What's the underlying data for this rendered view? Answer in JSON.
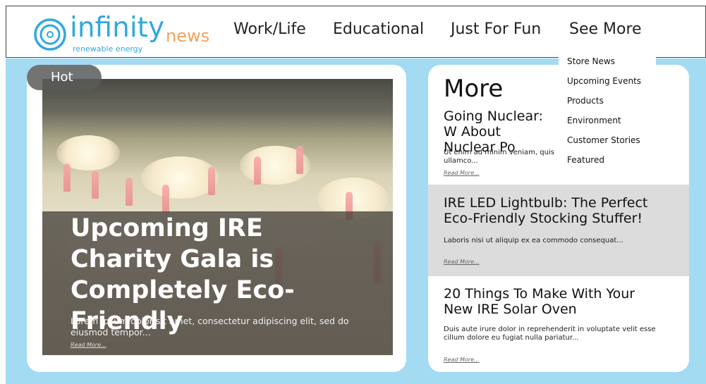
{
  "logo": {
    "word": "infinity",
    "tagline": "renewable energy",
    "section": "news"
  },
  "nav": {
    "items": [
      "Work/Life",
      "Educational",
      "Just For Fun",
      "See More"
    ]
  },
  "dropdown": {
    "items": [
      "Store News",
      "Upcoming Events",
      "Products",
      "Environment",
      "Customer Stories",
      "Featured"
    ]
  },
  "featured": {
    "badge": "Hot",
    "title": "Upcoming IRE Charity Gala is Completely Eco-Friendly",
    "excerpt": "Lorem ipsum dolor sit amet, consectetur adipiscing elit, sed do eiusmod tempor...",
    "read_more": "Read More..."
  },
  "more": {
    "heading": "More",
    "articles": [
      {
        "title": "Going Nuclear: W About Nuclear Po",
        "excerpt": "Ut enim ad minim veniam, quis ullamco...",
        "read_more": "Read More..."
      },
      {
        "title": "IRE LED Lightbulb: The Perfect Eco-Friendly Stocking Stuffer!",
        "excerpt": "Laboris nisi ut aliquip ex ea commodo consequat...",
        "read_more": "Read More..."
      },
      {
        "title": "20 Things To Make With Your New IRE Solar Oven",
        "excerpt": "Duis aute irure dolor in reprehenderit in voluptate velit esse cillum dolore eu fugiat nulla pariatur...",
        "read_more": "Read More..."
      }
    ]
  },
  "colors": {
    "brand_blue": "#35a8dc",
    "brand_orange": "#f3a15b",
    "background_blue": "#a3dbf2",
    "highlight_gray": "#dcdcdc"
  },
  "icons": [
    "logo-ring-icon"
  ]
}
